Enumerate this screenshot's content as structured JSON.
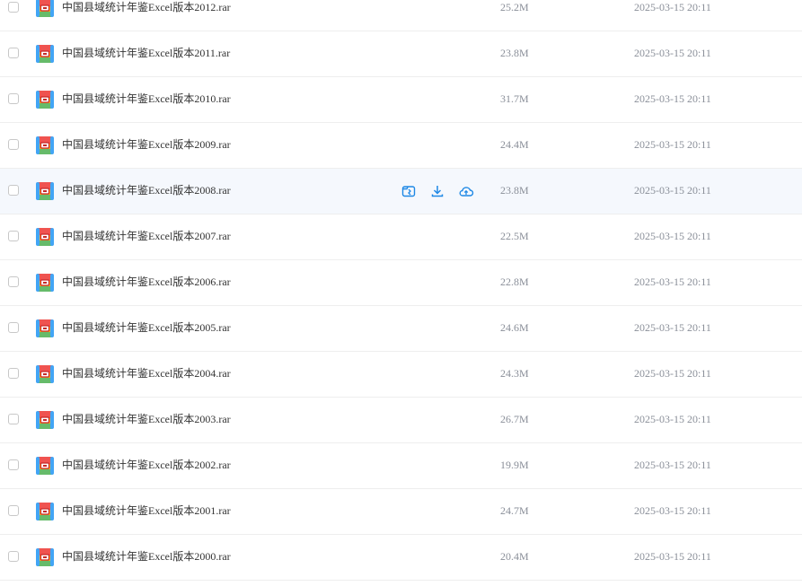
{
  "files": [
    {
      "name": "中国县域统计年鉴Excel版本2012.rar",
      "size": "25.2M",
      "date": "2025-03-15 20:11"
    },
    {
      "name": "中国县域统计年鉴Excel版本2011.rar",
      "size": "23.8M",
      "date": "2025-03-15 20:11"
    },
    {
      "name": "中国县域统计年鉴Excel版本2010.rar",
      "size": "31.7M",
      "date": "2025-03-15 20:11"
    },
    {
      "name": "中国县域统计年鉴Excel版本2009.rar",
      "size": "24.4M",
      "date": "2025-03-15 20:11"
    },
    {
      "name": "中国县域统计年鉴Excel版本2008.rar",
      "size": "23.8M",
      "date": "2025-03-15 20:11",
      "hovered": true
    },
    {
      "name": "中国县域统计年鉴Excel版本2007.rar",
      "size": "22.5M",
      "date": "2025-03-15 20:11"
    },
    {
      "name": "中国县域统计年鉴Excel版本2006.rar",
      "size": "22.8M",
      "date": "2025-03-15 20:11"
    },
    {
      "name": "中国县域统计年鉴Excel版本2005.rar",
      "size": "24.6M",
      "date": "2025-03-15 20:11"
    },
    {
      "name": "中国县域统计年鉴Excel版本2004.rar",
      "size": "24.3M",
      "date": "2025-03-15 20:11"
    },
    {
      "name": "中国县域统计年鉴Excel版本2003.rar",
      "size": "26.7M",
      "date": "2025-03-15 20:11"
    },
    {
      "name": "中国县域统计年鉴Excel版本2002.rar",
      "size": "19.9M",
      "date": "2025-03-15 20:11"
    },
    {
      "name": "中国县域统计年鉴Excel版本2001.rar",
      "size": "24.7M",
      "date": "2025-03-15 20:11"
    },
    {
      "name": "中国县域统计年鉴Excel版本2000.rar",
      "size": "20.4M",
      "date": "2025-03-15 20:11"
    }
  ],
  "row_actions": [
    {
      "icon": "share-icon"
    },
    {
      "icon": "download-icon"
    },
    {
      "icon": "cloud-save-icon"
    }
  ],
  "colors": {
    "accent": "#1e88e5",
    "hover_bg": "#f5f8fd",
    "muted_text": "#8a8f99"
  }
}
